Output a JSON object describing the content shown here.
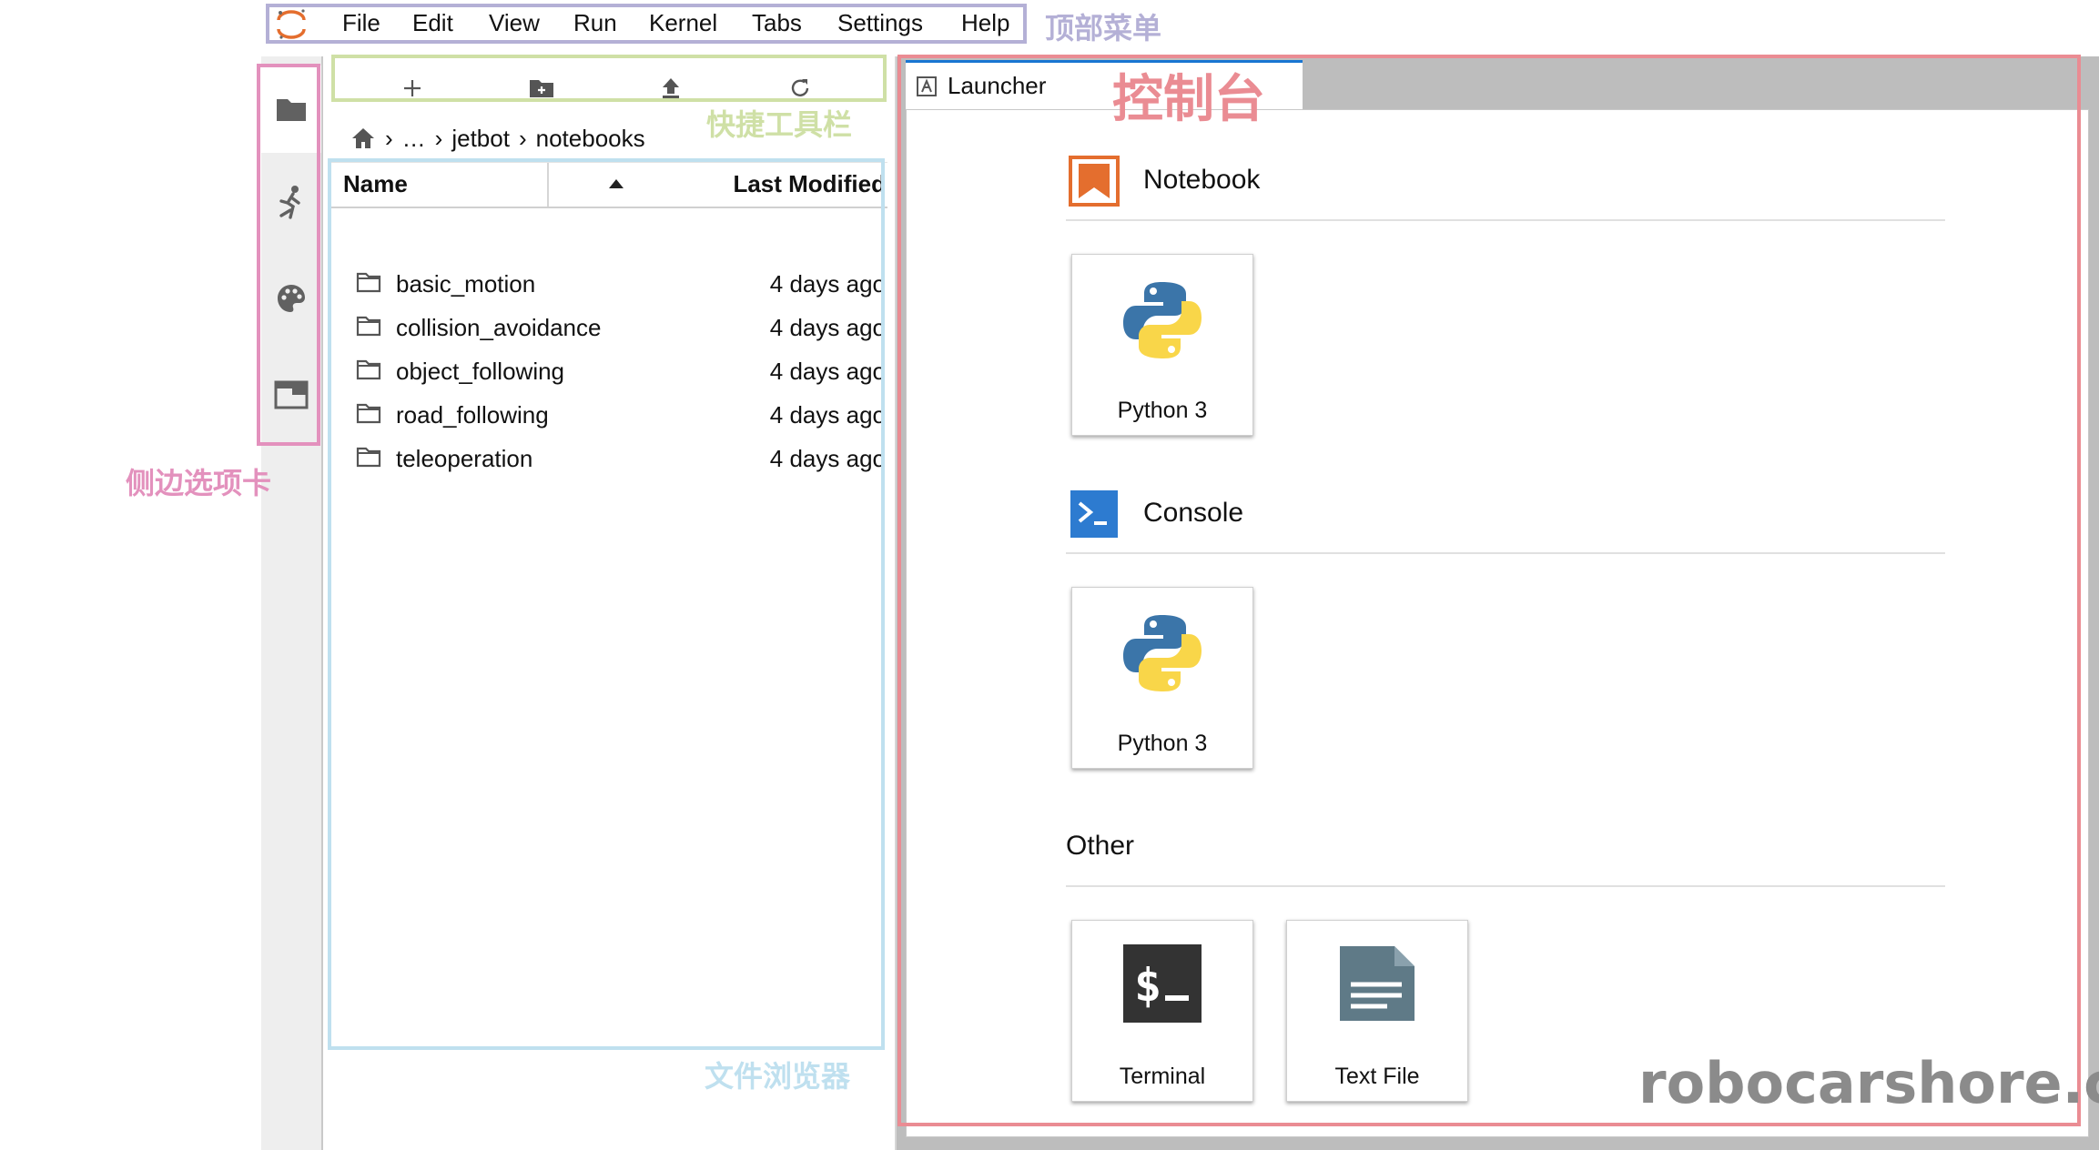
{
  "menu": {
    "items": [
      "File",
      "Edit",
      "View",
      "Run",
      "Kernel",
      "Tabs",
      "Settings",
      "Help"
    ]
  },
  "annotations": {
    "top_menu": "顶部菜单",
    "toolbar": "快捷工具栏",
    "console": "控制台",
    "side_tabs": "侧边选项卡",
    "file_browser": "文件浏览器"
  },
  "colors": {
    "top_menu": "#b4b0d6",
    "toolbar": "#cfe0a6",
    "console": "#ea8c93",
    "side_tabs": "#e391bd",
    "file_browser": "#bfe0ef"
  },
  "breadcrumbs": {
    "home_icon": "home-icon",
    "ellipsis": "…",
    "folder": "jetbot",
    "current": "notebooks"
  },
  "file_browser": {
    "columns": {
      "name": "Name",
      "modified": "Last Modified"
    },
    "files": [
      {
        "name": "basic_motion",
        "modified": "4 days ago"
      },
      {
        "name": "collision_avoidance",
        "modified": "4 days ago"
      },
      {
        "name": "object_following",
        "modified": "4 days ago"
      },
      {
        "name": "road_following",
        "modified": "4 days ago"
      },
      {
        "name": "teleoperation",
        "modified": "4 days ago"
      }
    ]
  },
  "main": {
    "tab_label": "Launcher",
    "sections": {
      "notebook": {
        "title": "Notebook",
        "card": "Python 3"
      },
      "console": {
        "title": "Console",
        "card": "Python 3"
      },
      "other": {
        "title": "Other",
        "cards": [
          "Terminal",
          "Text File"
        ]
      }
    }
  },
  "watermark": "robocarshore.cn"
}
